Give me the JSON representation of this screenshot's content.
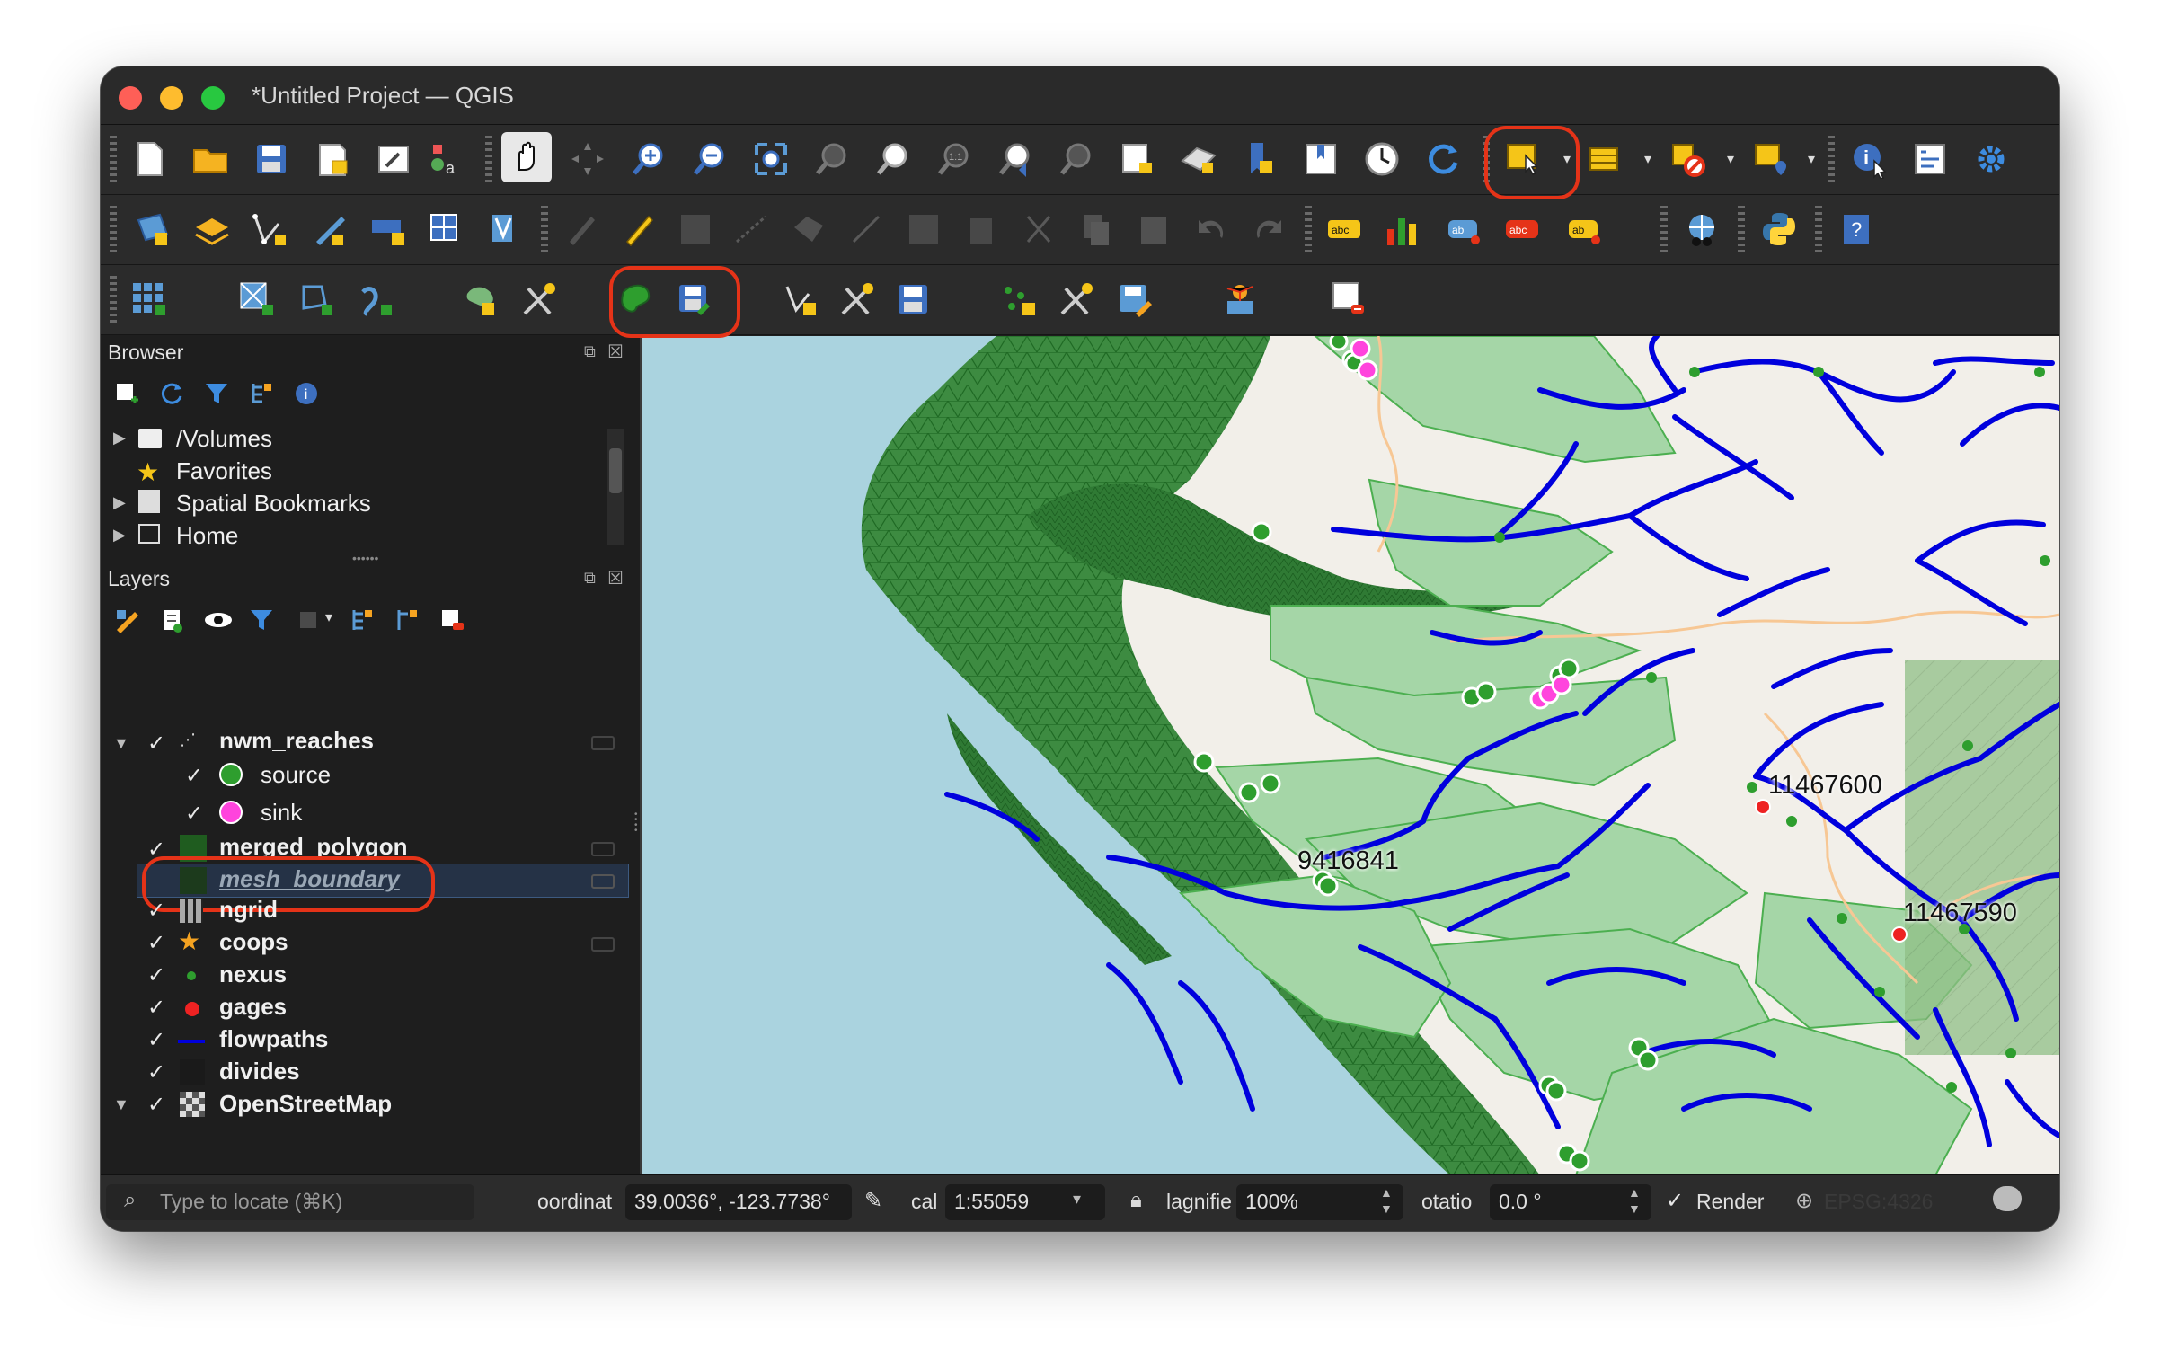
{
  "window": {
    "title": "*Untitled Project — QGIS"
  },
  "colors": {
    "window_bg": "#1e1e1e",
    "toolbar_bg": "#2b2b2b",
    "highlight": "#e53318",
    "water": "#aad3df",
    "land": "#f2efe9",
    "mesh": "#2e7d32",
    "divides": "#a5d6a7",
    "flowpaths": "#0000dd",
    "source": "#2e9e2e",
    "sink": "#ff44dd",
    "gages": "#ee2222"
  },
  "browser": {
    "title": "Browser",
    "items": [
      "/Volumes",
      "Favorites",
      "Spatial Bookmarks",
      "Home"
    ]
  },
  "layers": {
    "title": "Layers",
    "items": [
      {
        "name": "nwm_reaches",
        "checked": true,
        "expanded": true
      },
      {
        "name": "source",
        "checked": true,
        "legend_item": true
      },
      {
        "name": "sink",
        "checked": true,
        "legend_item": true
      },
      {
        "name": "merged_polygon",
        "checked": true
      },
      {
        "name": "mesh_boundary",
        "checked": false,
        "selected": true
      },
      {
        "name": "ngrid",
        "checked": true
      },
      {
        "name": "coops",
        "checked": true
      },
      {
        "name": "nexus",
        "checked": true
      },
      {
        "name": "gages",
        "checked": true
      },
      {
        "name": "flowpaths",
        "checked": true
      },
      {
        "name": "divides",
        "checked": true
      },
      {
        "name": "OpenStreetMap",
        "checked": true,
        "expanded": true
      }
    ]
  },
  "map": {
    "labels": {
      "gage_11467600": "11467600",
      "gage_11467590": "11467590",
      "coops_9416841": "9416841"
    }
  },
  "statusbar": {
    "locate_placeholder": "Type to locate (⌘K)",
    "coordinate_label": "oordinat",
    "coordinate_value": "39.0036°, -123.7738°",
    "scale_label": "cal",
    "scale_value": "1:55059",
    "magnifier_label": "lagnifie",
    "magnifier_value": "100%",
    "rotation_label": "otatio",
    "rotation_value": "0.0 °",
    "render_label": "Render",
    "crs": "EPSG:4326"
  },
  "icons": {
    "toolbar1": [
      "new-project-icon",
      "open-project-icon",
      "save-project-icon",
      "new-print-layout-icon",
      "layout-manager-icon",
      "style-manager-icon",
      "pan-icon",
      "pan-to-selection-icon",
      "zoom-in-icon",
      "zoom-out-icon",
      "zoom-full-icon",
      "zoom-to-selection-icon",
      "zoom-to-layer-icon",
      "zoom-native-icon",
      "zoom-last-icon",
      "zoom-next-icon",
      "new-map-view-icon",
      "new-3d-view-icon",
      "new-bookmark-icon",
      "show-bookmarks-icon",
      "temporal-controller-icon",
      "refresh-icon",
      "select-features-icon",
      "attribute-table-icon",
      "deselect-icon",
      "select-location-icon",
      "identify-icon",
      "statistics-icon",
      "settings-gear-icon"
    ],
    "toolbar2": [
      "data-source-manager-icon",
      "new-layer-icon",
      "digitize-icon",
      "edit-pen-icon",
      "add-feature-icon",
      "vertex-tool-icon",
      "toggle-editing-icon",
      "save-edits-icon",
      "undo-icon",
      "redo-icon",
      "label-icon",
      "python-icon",
      "help-icon"
    ],
    "toolbar3": [
      "mesh-grid-icon",
      "add-mesh-icon",
      "digitize-mesh-icon",
      "add-flow-icon",
      "polygon-edit-icon",
      "mesh-tools-icon",
      "save-mesh-icon",
      "vertex-add-icon",
      "save-layer-edits-icon",
      "points-add-icon",
      "remove-layer-icon"
    ]
  }
}
